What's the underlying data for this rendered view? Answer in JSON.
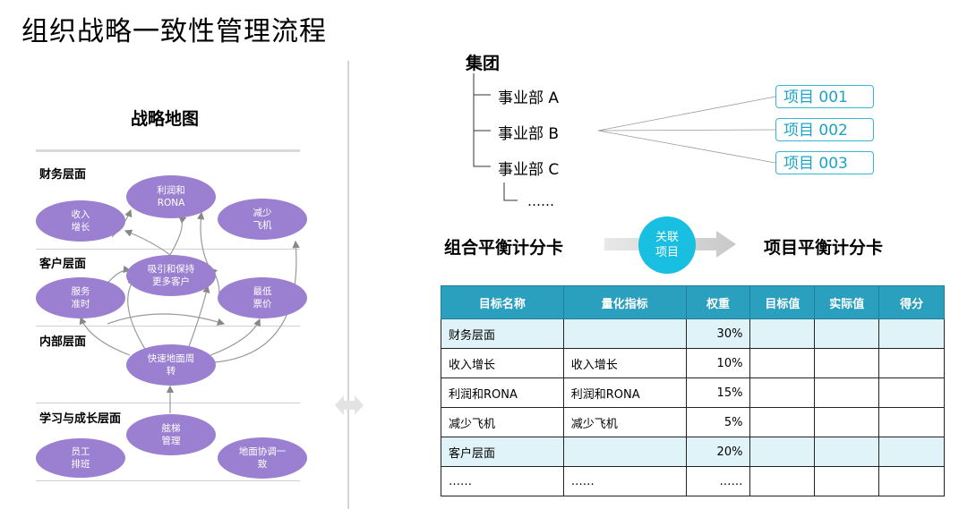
{
  "title": "组织战略一致性管理流程",
  "strategy_map": {
    "title": "战略地图",
    "layers": [
      "财务层面",
      "客户层面",
      "内部层面",
      "学习与成长层面"
    ],
    "nodes": {
      "revenue_growth": "收入\n增长",
      "profit_rona": "利润和\nRONA",
      "fewer_planes": "减少\n飞机",
      "attract_customers": "吸引和保持\n更多客户",
      "on_time_service": "服务\n准时",
      "lowest_fare": "最低\n票价",
      "fast_turnaround": "快速地面周\n转",
      "ladder_management": "舷梯\n管理",
      "staff_scheduling": "员工\n排班",
      "ground_coordination": "地面协调一\n致"
    },
    "color": "#9b7fd0"
  },
  "hierarchy": {
    "root": "集团",
    "divisions": [
      "事业部 A",
      "事业部 B",
      "事业部 C"
    ],
    "ellipsis": "……",
    "projects": [
      "项目 001",
      "项目 002",
      "项目 003"
    ]
  },
  "link": {
    "left_label": "组合平衡计分卡",
    "center_label_line1": "关联",
    "center_label_line2": "项目",
    "right_label": "项目平衡计分卡"
  },
  "table": {
    "headers": [
      "目标名称",
      "量化指标",
      "权重",
      "目标值",
      "实际值",
      "得分"
    ],
    "rows": [
      [
        "财务层面",
        "",
        "30%",
        "",
        "",
        ""
      ],
      [
        "收入增长",
        "收入增长",
        "10%",
        "",
        "",
        ""
      ],
      [
        "利润和RONA",
        "利润和RONA",
        "15%",
        "",
        "",
        ""
      ],
      [
        "减少飞机",
        "减少飞机",
        "5%",
        "",
        "",
        ""
      ],
      [
        "客户层面",
        "",
        "20%",
        "",
        "",
        ""
      ],
      [
        "……",
        "……",
        "……",
        "",
        "",
        ""
      ]
    ],
    "header_color": "#2a9fbe",
    "highlight_color": "#dff3f8"
  }
}
